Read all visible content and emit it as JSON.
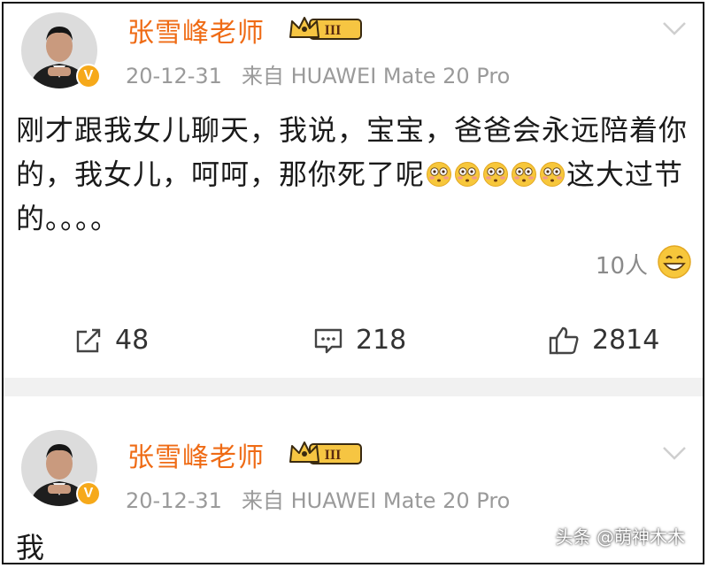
{
  "posts": [
    {
      "author": "张雪峰老师",
      "level_badge": "III",
      "verified_mark": "V",
      "timestamp": "20-12-31",
      "source_prefix": "来自",
      "device": "HUAWEI Mate 20 Pro",
      "text_part1": "刚才跟我女儿聊天，我说，宝宝，爸爸会永远陪着你的，我女儿，呵呵，那你死了呢",
      "text_emoji_count": 5,
      "text_part2": "这大过节的。。。。",
      "reaction_count": "10人",
      "reaction_icon": "grin-emoji-icon",
      "repost_count": "48",
      "comment_count": "218",
      "like_count": "2814"
    },
    {
      "author": "张雪峰老师",
      "level_badge": "III",
      "verified_mark": "V",
      "timestamp": "20-12-31",
      "source_prefix": "来自",
      "device": "HUAWEI Mate 20 Pro",
      "text_part1": "我"
    }
  ],
  "watermark": "头条 @萌神木木",
  "colors": {
    "author": "#ef6b15",
    "meta": "#9a9a9a",
    "badge_gold": "#f6a91a",
    "separator": "#f1f1f1"
  },
  "icons": [
    "chevron-down-icon",
    "repost-icon",
    "comment-icon",
    "like-icon",
    "crown-icon",
    "verified-icon",
    "flushed-emoji-icon"
  ]
}
